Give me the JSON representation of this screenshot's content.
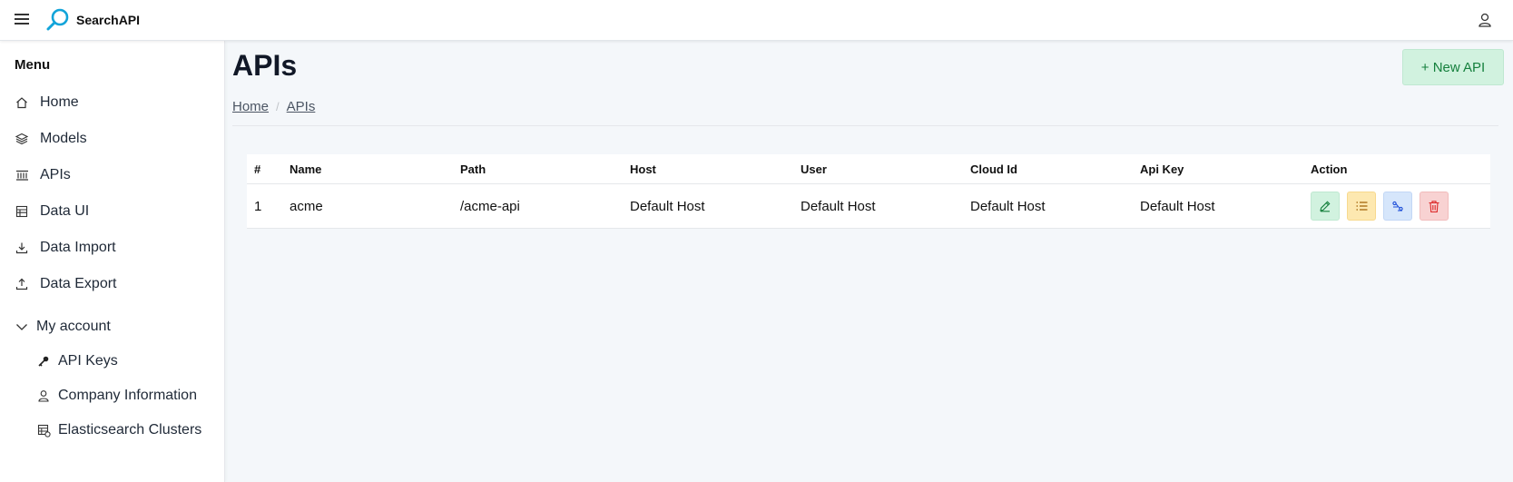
{
  "header": {
    "brand": "SearchAPI"
  },
  "sidebar": {
    "title": "Menu",
    "items": [
      {
        "label": "Home",
        "icon": "home-icon"
      },
      {
        "label": "Models",
        "icon": "layers-icon"
      },
      {
        "label": "APIs",
        "icon": "api-icon"
      },
      {
        "label": "Data UI",
        "icon": "table-icon"
      },
      {
        "label": "Data Import",
        "icon": "download-icon"
      },
      {
        "label": "Data Export",
        "icon": "upload-icon"
      }
    ],
    "account": {
      "label": "My account",
      "items": [
        {
          "label": "API Keys",
          "icon": "key-icon"
        },
        {
          "label": "Company Information",
          "icon": "user-icon"
        },
        {
          "label": "Elasticsearch Clusters",
          "icon": "cluster-icon"
        }
      ]
    }
  },
  "main": {
    "title": "APIs",
    "new_button": "+ New API",
    "breadcrumb": [
      "Home",
      "APIs"
    ],
    "breadcrumb_sep": "/"
  },
  "table": {
    "columns": [
      "#",
      "Name",
      "Path",
      "Host",
      "User",
      "Cloud Id",
      "Api Key",
      "Action"
    ],
    "rows": [
      {
        "num": "1",
        "name": "acme",
        "path": "/acme-api",
        "host": "Default Host",
        "user": "Default Host",
        "cloud_id": "Default Host",
        "api_key": "Default Host"
      }
    ]
  },
  "colors": {
    "accent_green": "#15803d",
    "edit_bg": "#d1f2df",
    "list_bg": "#fde8b0",
    "link_bg": "#d6e6fb",
    "delete_bg": "#f8d2d2"
  }
}
